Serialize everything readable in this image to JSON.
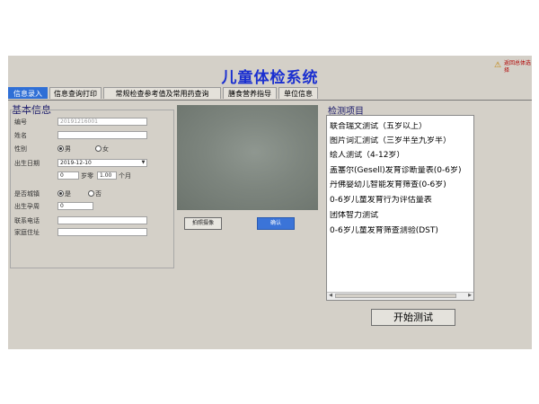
{
  "app": {
    "title": "儿童体检系统",
    "corner_text": "返回总体选择"
  },
  "tabs": [
    {
      "label": "信息录入",
      "active": true
    },
    {
      "label": "信息查询打印",
      "active": false
    },
    {
      "label": "常规检查参考值及常用药查询",
      "active": false
    },
    {
      "label": "膳食营养指导",
      "active": false
    },
    {
      "label": "单位信息",
      "active": false
    }
  ],
  "basic_info": {
    "title": "基本信息",
    "id_label": "编号",
    "id_value": "20191216001",
    "name_label": "姓名",
    "gender_label": "性别",
    "gender_male": "男",
    "gender_female": "女",
    "birth_label": "出生日期",
    "birth_value": "2019-12-10",
    "age_years": "0",
    "age_years_unit": "岁零",
    "age_months": "1.00",
    "age_months_unit": "个月",
    "urban_label": "是否城镇",
    "urban_yes": "是",
    "urban_no": "否",
    "gestation_label": "出生孕周",
    "gestation_value": "0",
    "phone_label": "联系电话",
    "address_label": "家庭住址"
  },
  "photo_buttons": {
    "capture": "拍照摄像",
    "confirm": "确认"
  },
  "tests": {
    "title": "检测项目",
    "items": [
      "联合瑞文测试（五岁以上）",
      "图片词汇测试（三岁半至九岁半）",
      "绘人测试（4-12岁）",
      "盖塞尔(Gesell)发育诊断量表(0-6岁)",
      "丹佛婴幼儿智能发育筛查(0-6岁)",
      "0-6岁儿童发育行为评估量表",
      "团体智力测试",
      "0-6岁儿童发育筛查测验(DST)"
    ]
  },
  "start_button": "开始测试",
  "colors": {
    "title": "#1a2fd0",
    "tab_active": "#2f6fd6",
    "window_bg": "#d4d0c8"
  }
}
